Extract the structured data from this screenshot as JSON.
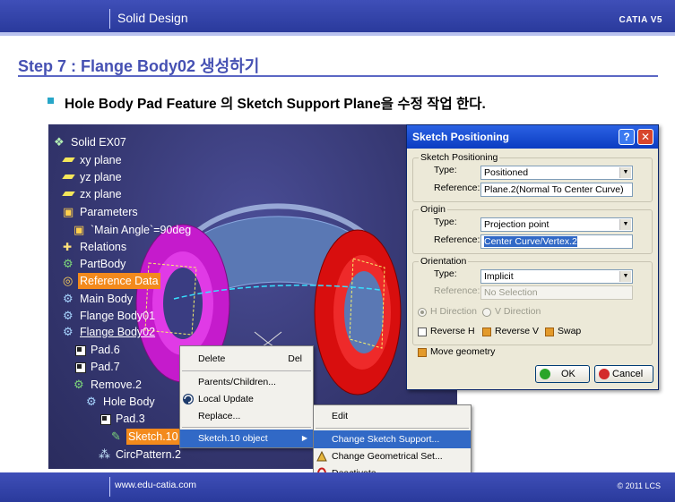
{
  "slide": {
    "subject": "Solid Design",
    "brand": "CATIA V5",
    "step_title": "Step 7 : Flange Body02 생성하기",
    "bullet_text": "Hole Body  Pad Feature 의 Sketch Support Plane을 수정 작업 한다.",
    "footer_url": "www.edu-catia.com",
    "footer_copyright": "© 2011 LCS",
    "colors": {
      "bar": "#3344aa",
      "title": "#4651b3",
      "bullet": "#27a6c8",
      "highlight": "#f38a1c",
      "menu_highlight": "#3169c6"
    }
  },
  "tree": {
    "items": [
      {
        "label": "Solid EX07",
        "icon": "part-icon"
      },
      {
        "label": "xy plane",
        "icon": "plane-icon"
      },
      {
        "label": "yz plane",
        "icon": "plane-icon"
      },
      {
        "label": "zx plane",
        "icon": "plane-icon"
      },
      {
        "label": "Parameters",
        "icon": "parameters-icon"
      },
      {
        "label": "`Main Angle`=90deg",
        "icon": "parameter-icon"
      },
      {
        "label": "Relations",
        "icon": "relations-icon"
      },
      {
        "label": "PartBody",
        "icon": "body-icon"
      },
      {
        "label": "Reference Data",
        "icon": "reference-icon"
      },
      {
        "label": "Main Body",
        "icon": "body-icon"
      },
      {
        "label": "Flange Body01",
        "icon": "body-icon"
      },
      {
        "label": "Flange Body02",
        "icon": "body-icon"
      },
      {
        "label": "Pad.6",
        "icon": "pad-icon"
      },
      {
        "label": "Pad.7",
        "icon": "pad-icon"
      },
      {
        "label": "Remove.2",
        "icon": "remove-icon"
      },
      {
        "label": "Hole Body",
        "icon": "body-icon"
      },
      {
        "label": "Pad.3",
        "icon": "pad-icon"
      },
      {
        "label": "Sketch.10",
        "icon": "sketch-icon"
      },
      {
        "label": "CircPattern.2",
        "icon": "pattern-icon"
      }
    ]
  },
  "context_menu": {
    "items": [
      {
        "label": "Delete",
        "mnemonic": "D",
        "shortcut": "Del"
      },
      {
        "label": "Parents/Children...",
        "mnemonic": "r"
      },
      {
        "label": "Local Update",
        "mnemonic": "L",
        "icon": "update-icon"
      },
      {
        "label": "Replace...",
        "mnemonic": ""
      },
      {
        "label": "Sketch.10 object",
        "mnemonic": "k"
      }
    ]
  },
  "submenu": {
    "items": [
      {
        "label": "Edit",
        "mnemonic": "E"
      },
      {
        "label": "Change Sketch Support...",
        "mnemonic": "C"
      },
      {
        "label": "Change Geometrical Set...",
        "mnemonic": "h",
        "icon": "geometrical-set-icon"
      },
      {
        "label": "Deactivate",
        "mnemonic": "D",
        "icon": "deactivate-icon"
      }
    ]
  },
  "dialog": {
    "title": "Sketch Positioning",
    "help_label": "?",
    "close_label": "✕",
    "sketch_positioning": {
      "group_label": "Sketch Positioning",
      "type_label": "Type:",
      "type_value": "Positioned",
      "reference_label": "Reference:",
      "reference_value": "Plane.2(Normal To Center Curve)"
    },
    "origin": {
      "group_label": "Origin",
      "type_label": "Type:",
      "type_value": "Projection point",
      "reference_label": "Reference:",
      "reference_value": "Center Curve/Vertex.2"
    },
    "orientation": {
      "group_label": "Orientation",
      "type_label": "Type:",
      "type_value": "Implicit",
      "reference_label": "Reference:",
      "reference_value": "No Selection",
      "h_direction_label": "H Direction",
      "v_direction_label": "V Direction",
      "reverse_h_label": "Reverse H",
      "reverse_v_label": "Reverse V",
      "swap_label": "Swap"
    },
    "move_geometry_label": "Move geometry",
    "ok_label": "OK",
    "cancel_label": "Cancel"
  }
}
